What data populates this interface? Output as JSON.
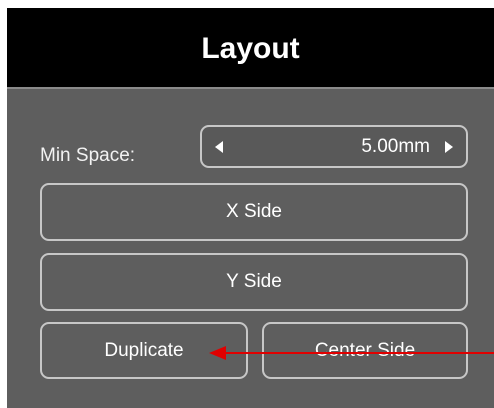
{
  "panel": {
    "title": "Layout",
    "min_space": {
      "label": "Min Space:",
      "value": "5.00mm"
    },
    "buttons": {
      "x_side": "X Side",
      "y_side": "Y Side",
      "duplicate": "Duplicate",
      "center_side": "Center Side"
    }
  },
  "annotation": {
    "arrow_color": "#e00000",
    "points_to": "Duplicate"
  },
  "colors": {
    "panel_bg": "#5e5e5e",
    "header_bg": "#000000",
    "border": "#c7c7c7",
    "text": "#ffffff"
  }
}
